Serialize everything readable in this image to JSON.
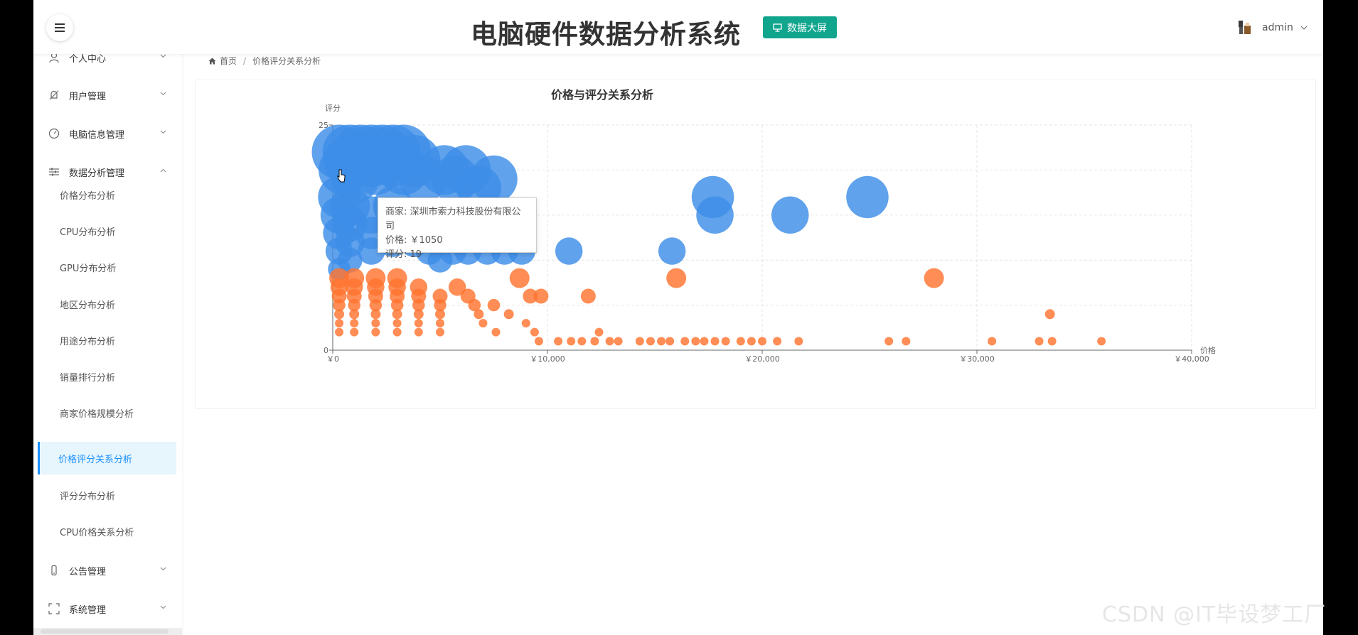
{
  "header": {
    "title": "电脑硬件数据分析系统",
    "screen_button": "数据大屏",
    "username": "admin"
  },
  "sidebar": {
    "menus": [
      {
        "label": "个人中心",
        "icon": "user-icon",
        "expanded": false
      },
      {
        "label": "用户管理",
        "icon": "bell-off-icon",
        "expanded": false
      },
      {
        "label": "电脑信息管理",
        "icon": "dashboard-icon",
        "expanded": false
      },
      {
        "label": "数据分析管理",
        "icon": "sliders-icon",
        "expanded": true
      },
      {
        "label": "公告管理",
        "icon": "phone-icon",
        "expanded": false
      },
      {
        "label": "系统管理",
        "icon": "fullscreen-icon",
        "expanded": false
      }
    ],
    "sub_items": [
      "价格分布分析",
      "CPU分布分析",
      "GPU分布分析",
      "地区分布分析",
      "用途分布分析",
      "销量排行分析",
      "商家价格规模分析",
      "价格评分关系分析",
      "评分分布分析",
      "CPU价格关系分析"
    ],
    "active_sub": "价格评分关系分析"
  },
  "breadcrumb": {
    "home": "首页",
    "current": "价格评分关系分析"
  },
  "tooltip": {
    "line1": "商家: 深圳市索力科技股份有限公司",
    "line2": "价格: ￥1050",
    "line3": "评分: 19"
  },
  "watermark": "CSDN @IT毕设梦工厂",
  "colors": {
    "accent": "#11a58e",
    "active_menu": "#1890ff",
    "series_blue": "#3d8ee8",
    "series_orange": "#ff7430"
  },
  "chart_data": {
    "type": "scatter",
    "title": "价格与评分关系分析",
    "xlabel": "价格",
    "ylabel": "评分",
    "xlim": [
      0,
      40000
    ],
    "ylim": [
      0,
      25
    ],
    "x_ticks": [
      "￥0",
      "￥10,000",
      "￥20,000",
      "￥30,000",
      "￥40,000"
    ],
    "y_ticks": [
      "0",
      "25"
    ],
    "grid": true,
    "series": [
      {
        "color": "#3d8ee8",
        "points": [
          [
            300,
            22
          ],
          [
            800,
            22
          ],
          [
            1300,
            22
          ],
          [
            1800,
            22
          ],
          [
            2300,
            22
          ],
          [
            2800,
            22
          ],
          [
            3300,
            22
          ],
          [
            800,
            21
          ],
          [
            1800,
            21
          ],
          [
            2800,
            21
          ],
          [
            3800,
            21
          ],
          [
            1050,
            19
          ],
          [
            500,
            20
          ],
          [
            2000,
            20
          ],
          [
            3300,
            20
          ],
          [
            5200,
            20
          ],
          [
            6200,
            20
          ],
          [
            7500,
            19
          ],
          [
            4200,
            19
          ],
          [
            5700,
            19
          ],
          [
            6800,
            18
          ],
          [
            300,
            17
          ],
          [
            300,
            15
          ],
          [
            300,
            13
          ],
          [
            300,
            11
          ],
          [
            300,
            9
          ],
          [
            800,
            16
          ],
          [
            800,
            14
          ],
          [
            800,
            12
          ],
          [
            800,
            10
          ],
          [
            1800,
            15
          ],
          [
            1800,
            13
          ],
          [
            1800,
            11
          ],
          [
            2800,
            16
          ],
          [
            2800,
            14
          ],
          [
            2800,
            12
          ],
          [
            3800,
            14
          ],
          [
            3800,
            12
          ],
          [
            4500,
            11
          ],
          [
            5000,
            10
          ],
          [
            5600,
            11
          ],
          [
            6300,
            11
          ],
          [
            7200,
            11
          ],
          [
            8000,
            11
          ],
          [
            8800,
            11
          ],
          [
            11000,
            11
          ],
          [
            17700,
            17
          ],
          [
            17800,
            15
          ],
          [
            21300,
            15
          ],
          [
            24900,
            17
          ],
          [
            15800,
            11
          ]
        ]
      },
      {
        "color": "#ff7430",
        "points": [
          [
            300,
            8
          ],
          [
            300,
            7
          ],
          [
            300,
            6
          ],
          [
            300,
            5
          ],
          [
            300,
            4
          ],
          [
            300,
            3
          ],
          [
            300,
            2
          ],
          [
            1000,
            8
          ],
          [
            1000,
            7
          ],
          [
            1000,
            6
          ],
          [
            1000,
            5
          ],
          [
            1000,
            4
          ],
          [
            1000,
            3
          ],
          [
            1000,
            2
          ],
          [
            2000,
            8
          ],
          [
            2000,
            7
          ],
          [
            2000,
            6
          ],
          [
            2000,
            5
          ],
          [
            2000,
            4
          ],
          [
            2000,
            3
          ],
          [
            2000,
            2
          ],
          [
            3000,
            8
          ],
          [
            3000,
            7
          ],
          [
            3000,
            6
          ],
          [
            3000,
            5
          ],
          [
            3000,
            4
          ],
          [
            3000,
            3
          ],
          [
            3000,
            2
          ],
          [
            4000,
            7
          ],
          [
            4000,
            6
          ],
          [
            4000,
            5
          ],
          [
            4000,
            4
          ],
          [
            4000,
            3
          ],
          [
            4000,
            2
          ],
          [
            5000,
            6
          ],
          [
            5000,
            5
          ],
          [
            5000,
            4
          ],
          [
            5000,
            3
          ],
          [
            5000,
            2
          ],
          [
            5800,
            7
          ],
          [
            6300,
            6
          ],
          [
            6600,
            5
          ],
          [
            6800,
            4
          ],
          [
            7000,
            3
          ],
          [
            7500,
            5
          ],
          [
            8200,
            4
          ],
          [
            8700,
            8
          ],
          [
            9200,
            6
          ],
          [
            9700,
            6
          ],
          [
            9000,
            3
          ],
          [
            9400,
            2
          ],
          [
            7600,
            2
          ],
          [
            11900,
            6
          ],
          [
            12400,
            2
          ],
          [
            16000,
            8
          ],
          [
            28000,
            8
          ],
          [
            33400,
            4
          ],
          [
            9600,
            1
          ],
          [
            10500,
            1
          ],
          [
            11100,
            1
          ],
          [
            11600,
            1
          ],
          [
            12200,
            1
          ],
          [
            12900,
            1
          ],
          [
            13300,
            1
          ],
          [
            14300,
            1
          ],
          [
            14800,
            1
          ],
          [
            15300,
            1
          ],
          [
            15700,
            1
          ],
          [
            16400,
            1
          ],
          [
            16900,
            1
          ],
          [
            17300,
            1
          ],
          [
            17800,
            1
          ],
          [
            18300,
            1
          ],
          [
            19000,
            1
          ],
          [
            19500,
            1
          ],
          [
            20000,
            1
          ],
          [
            20700,
            1
          ],
          [
            21700,
            1
          ],
          [
            25900,
            1
          ],
          [
            26700,
            1
          ],
          [
            30700,
            1
          ],
          [
            32900,
            1
          ],
          [
            33500,
            1
          ],
          [
            35800,
            1
          ]
        ]
      }
    ]
  }
}
